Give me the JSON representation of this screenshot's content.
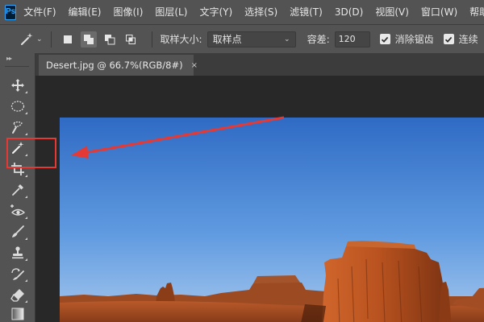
{
  "app": {
    "logo_text": "Ps"
  },
  "menu": {
    "items": [
      "文件(F)",
      "编辑(E)",
      "图像(I)",
      "图层(L)",
      "文字(Y)",
      "选择(S)",
      "滤镜(T)",
      "3D(D)",
      "视图(V)",
      "窗口(W)",
      "帮助"
    ]
  },
  "options": {
    "tool_preset_icon": "magic-wand-icon",
    "selection_modes": [
      "new-selection-icon",
      "add-to-selection-icon",
      "subtract-from-selection-icon",
      "intersect-selection-icon"
    ],
    "sample_size_label": "取样大小:",
    "sample_size_value": "取样点",
    "tolerance_label": "容差:",
    "tolerance_value": "120",
    "antialias_label": "消除锯齿",
    "antialias_checked": true,
    "contiguous_label": "连续",
    "contiguous_checked": true
  },
  "toolbar": {
    "tools": [
      "move-tool-icon",
      "elliptical-marquee-icon",
      "quick-selection-icon",
      "magic-wand-icon",
      "crop-icon",
      "eyedropper-icon",
      "red-eye-icon",
      "brush-icon",
      "clone-stamp-icon",
      "history-brush-icon",
      "eraser-icon",
      "gradient-icon"
    ],
    "highlighted_tool": "magic-wand-icon"
  },
  "document": {
    "tab_title": "Desert.jpg @ 66.7%(RGB/8#)",
    "close_glyph": "×"
  },
  "annotation": {
    "color": "#e53935"
  }
}
